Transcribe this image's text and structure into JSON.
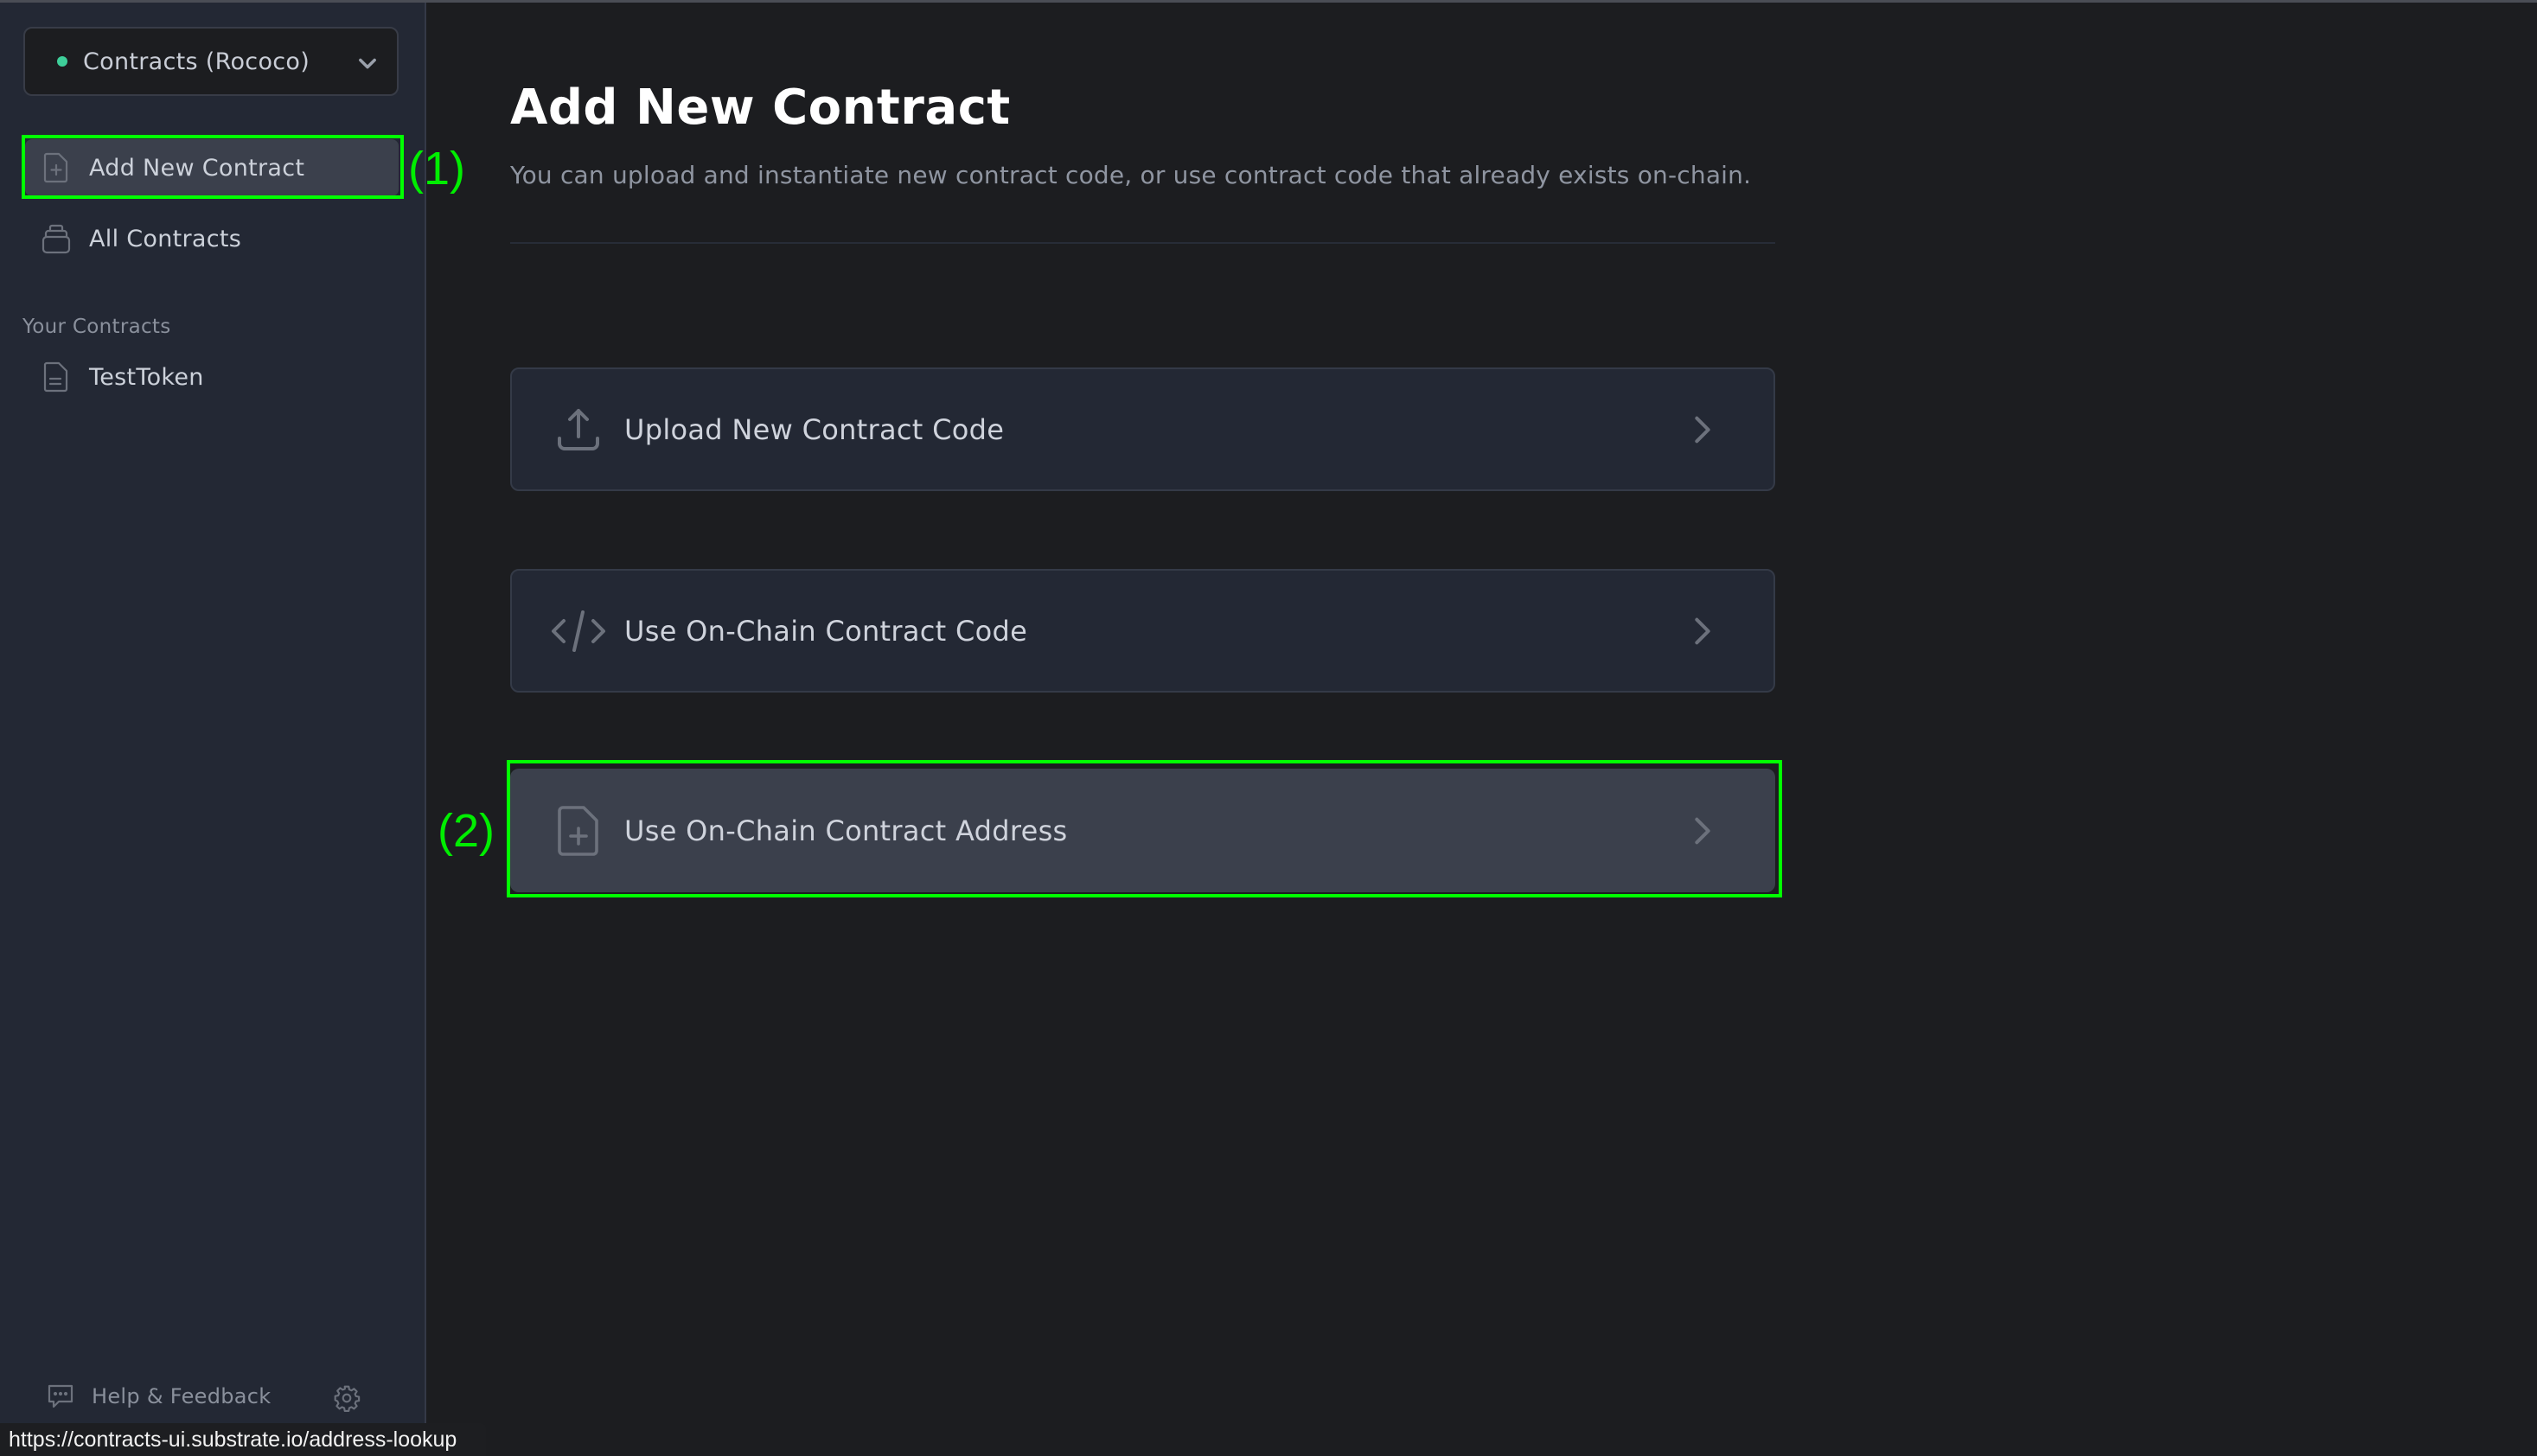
{
  "sidebar": {
    "network_selector": {
      "label": "Contracts (Rococo)",
      "status_color": "#3ecf9a"
    },
    "nav": [
      {
        "label": "Add New Contract",
        "icon": "file-plus-icon",
        "active": true
      },
      {
        "label": "All Contracts",
        "icon": "stack-icon",
        "active": false
      }
    ],
    "your_contracts_heading": "Your Contracts",
    "contracts": [
      {
        "label": "TestToken",
        "icon": "document-icon"
      }
    ],
    "footer": {
      "help_label": "Help & Feedback",
      "help_icon": "chat-bubble-icon",
      "settings_icon": "gear-icon"
    }
  },
  "main": {
    "title": "Add New Contract",
    "subtitle": "You can upload and instantiate new contract code, or use contract code that already exists on-chain.",
    "options": [
      {
        "label": "Upload New Contract Code",
        "icon": "upload-icon"
      },
      {
        "label": "Use On-Chain Contract Code",
        "icon": "code-icon"
      },
      {
        "label": "Use On-Chain Contract Address",
        "icon": "file-plus-icon",
        "hovered": true
      }
    ]
  },
  "annotations": [
    {
      "label": "(1)",
      "target": "Add New Contract"
    },
    {
      "label": "(2)",
      "target": "Use On-Chain Contract Address"
    }
  ],
  "status_bar": {
    "url": "https://contracts-ui.substrate.io/address-lookup"
  },
  "colors": {
    "annotation": "#00ff00",
    "sidebar_bg": "#232834",
    "main_bg": "#1c1d20",
    "card_bg": "#232834",
    "card_hover_bg": "#3b404c"
  }
}
